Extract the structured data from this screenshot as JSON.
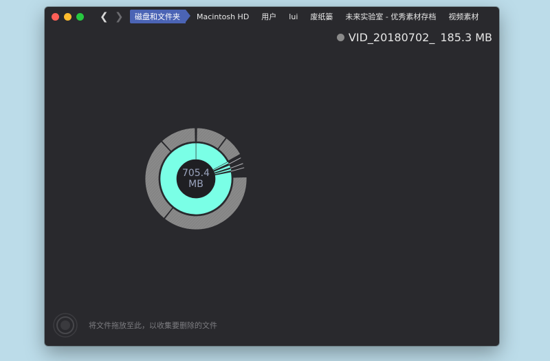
{
  "window": {
    "nav": {
      "back_icon": "chevron-left-icon",
      "back_glyph": "❮",
      "forward_icon": "chevron-right-icon",
      "forward_glyph": "❯"
    },
    "breadcrumb": [
      "磁盘和文件夹",
      "Macintosh HD",
      "用户",
      "lui",
      "废纸篓",
      "未来实验室 - 优秀素材存档",
      "视频素材"
    ]
  },
  "file_info": {
    "dot_color": "#8a8a8a",
    "name": "VID_20180702_",
    "size": "185.3 MB"
  },
  "chart_data": {
    "type": "sunburst",
    "center": {
      "value": "705.4",
      "unit": "MB"
    },
    "colors": {
      "inner": "#7affe6",
      "outer": "#8a8a8a"
    },
    "inner_ring": [
      {
        "start_deg": 0,
        "end_deg": 62,
        "kind": "dir"
      },
      {
        "start_deg": 62,
        "end_deg": 65,
        "kind": "file"
      },
      {
        "start_deg": 68,
        "end_deg": 72,
        "kind": "file"
      },
      {
        "start_deg": 74,
        "end_deg": 77,
        "kind": "file"
      },
      {
        "start_deg": 79,
        "end_deg": 360,
        "kind": "dir"
      }
    ],
    "outer_ring": [
      {
        "start_deg": 1,
        "end_deg": 36
      },
      {
        "start_deg": 37,
        "end_deg": 61
      },
      {
        "start_deg": 88,
        "end_deg": 218
      },
      {
        "start_deg": 219,
        "end_deg": 317
      },
      {
        "start_deg": 318,
        "end_deg": 359
      }
    ],
    "spikes_deg": [
      66,
      73,
      78
    ]
  },
  "drop_zone": {
    "icon": "drop-target-icon",
    "text": "将文件拖放至此，以收集要删除的文件"
  }
}
